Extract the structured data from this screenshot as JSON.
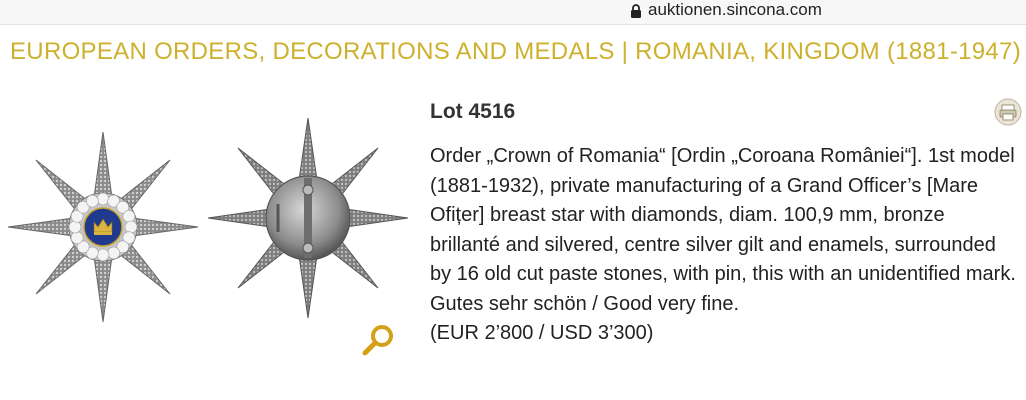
{
  "browser": {
    "url": "auktionen.sincona.com",
    "lock_icon": "lock-icon"
  },
  "header": {
    "category": "EUROPEAN ORDERS, DECORATIONS AND MEDALS | ROMANIA, KINGDOM (1881-1947)"
  },
  "lot": {
    "number": "Lot 4516",
    "description": "Order „Crown of Romania“ [Ordin „Coroana României“]. 1st model (1881-1932), private manufacturing of a Grand Officer’s [Mare Ofițer] breast star with diamonds, diam. 100,9 mm, bronze brillanté and silvered, centre silver gilt and enamels, surrounded by 16 old cut paste stones, with pin, this with an unidentified mark.",
    "condition": "Gutes sehr schön / Good very fine.",
    "estimate": "(EUR 2’800 / USD 3’300)"
  },
  "icons": {
    "zoom": "magnifier-icon",
    "corner": "print-icon"
  },
  "colors": {
    "category_gold": "#cdb12e",
    "zoom_gold": "#d4a017"
  }
}
